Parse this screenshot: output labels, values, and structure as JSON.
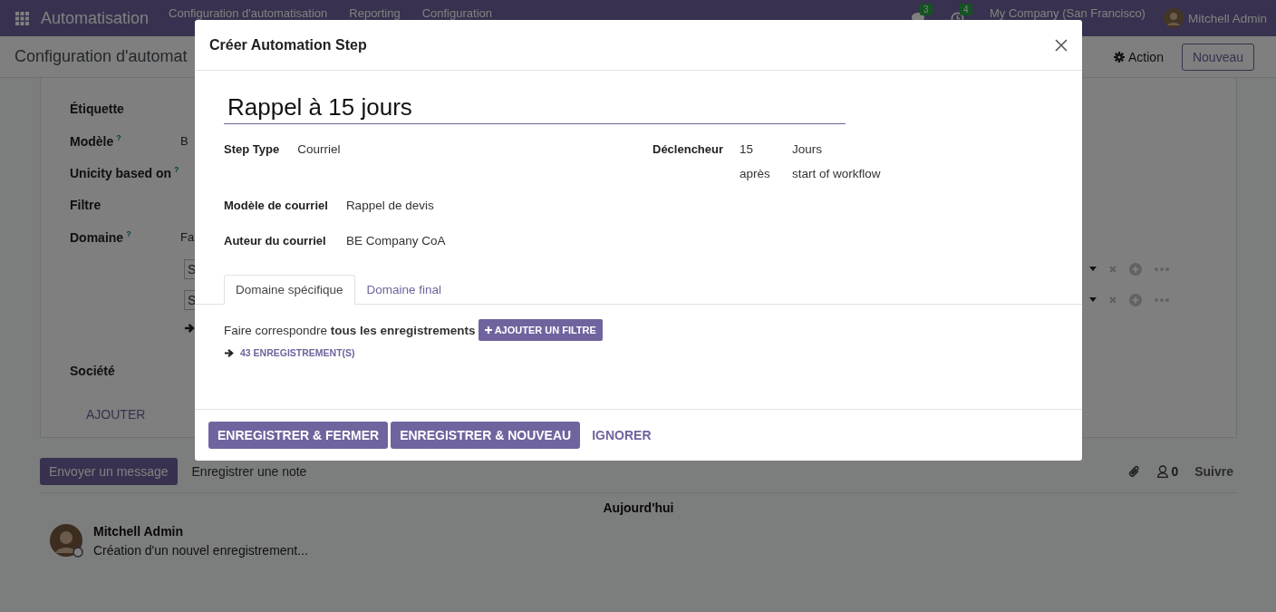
{
  "navbar": {
    "app_name": "Automatisation",
    "menu": [
      "Configuration d'automatisation",
      "Reporting",
      "Configuration"
    ],
    "messages_badge": "3",
    "activities_badge": "4",
    "company": "My Company (San Francisco)",
    "user": "Mitchell Admin"
  },
  "control_panel": {
    "breadcrumb": "Configuration d'automat",
    "action": "Action",
    "new_button": "Nouveau"
  },
  "form": {
    "fields": [
      {
        "label": "Étiquette"
      },
      {
        "label": "Modèle",
        "help_mark": "?",
        "value": "B"
      },
      {
        "label": "Unicity based on",
        "help_mark": "?"
      },
      {
        "label": "Filtre"
      },
      {
        "label": "Domaine",
        "help_mark": "?",
        "value": "Fa",
        "conditions": [
          "S",
          "S"
        ]
      },
      {
        "label": "Société"
      }
    ],
    "add_link": "AJOUTER"
  },
  "chatter": {
    "send_button": "Envoyer un message",
    "note_button": "Enregistrer une note",
    "followers": "0",
    "follow": "Suivre",
    "date_separator": "Aujourd'hui",
    "messages": [
      {
        "author": "Mitchell Admin",
        "body": "Création d'un nouvel enregistrement..."
      }
    ]
  },
  "dialog": {
    "title": "Créer Automation Step",
    "name": "Rappel à 15 jours",
    "step_fields": [
      {
        "label": "Step Type",
        "value": "Courriel"
      }
    ],
    "trigger": {
      "label": "Déclencheur",
      "number": "15",
      "unit": "Jours",
      "relation": "après",
      "event": "start of workflow"
    },
    "mail_fields": [
      {
        "label": "Modèle de courriel",
        "value": "Rappel de devis"
      },
      {
        "label": "Auteur du courriel",
        "value": "BE Company CoA"
      }
    ],
    "tabs": [
      {
        "label": "Domaine spécifique",
        "selected": true
      },
      {
        "label": "Domaine final",
        "selected": false
      }
    ],
    "domain": {
      "text": "Faire correspondre **tous les enregistrements**",
      "add_filter": "AJOUTER UN FILTRE",
      "records": "43 ENREGISTREMENT(S)"
    },
    "buttons": [
      {
        "label": "ENREGISTRER & FERMER",
        "kind": "primary"
      },
      {
        "label": "ENREGISTRER & NOUVEAU",
        "kind": "primary"
      },
      {
        "label": "IGNORER",
        "kind": "link"
      }
    ]
  }
}
